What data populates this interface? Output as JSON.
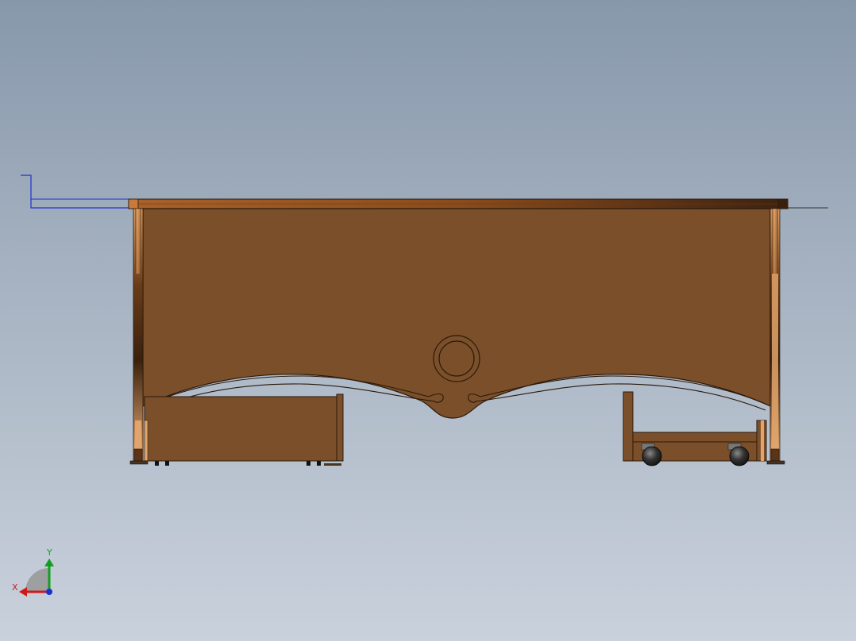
{
  "viewport": {
    "background_top": "#8798ab",
    "background_bottom": "#c9d1dc"
  },
  "model": {
    "name": "",
    "view": "front",
    "colors": {
      "wood": "#7a4f2a",
      "wood_dark": "#5a3518",
      "wood_light": "#e2a46a",
      "top_edge": "#8a5220",
      "outline": "#2a1a0c",
      "caster": "#2a2a2a"
    }
  },
  "triad": {
    "x_label": "X",
    "y_label": "Y",
    "x_color": "#d01818",
    "y_color": "#10a020",
    "z_color": "#1830d0"
  },
  "sketch_origin": {
    "color": "#2030d0"
  }
}
